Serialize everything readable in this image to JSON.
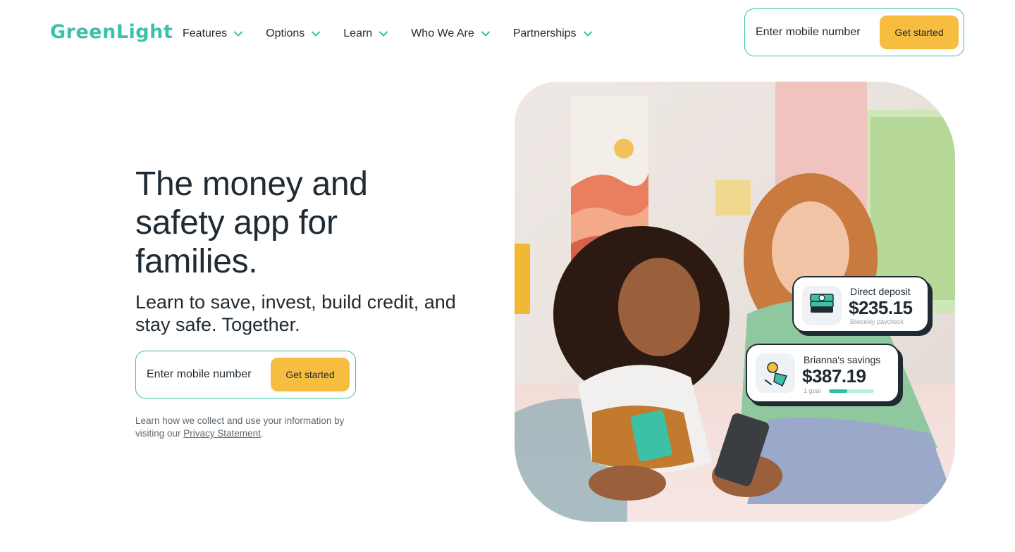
{
  "colors": {
    "brand": "#3cc0a6",
    "accent": "#f6bd41",
    "text": "#1f2a33"
  },
  "header": {
    "logo_text": "GreenLight",
    "nav": [
      {
        "label": "Features",
        "icon": "chevron-down-icon"
      },
      {
        "label": "Options",
        "icon": "chevron-down-icon"
      },
      {
        "label": "Learn",
        "icon": "chevron-down-icon"
      },
      {
        "label": "Who We Are",
        "icon": "chevron-down-icon"
      },
      {
        "label": "Partnerships",
        "icon": "chevron-down-icon"
      }
    ],
    "signup": {
      "placeholder": "Enter mobile number",
      "button_label": "Get started"
    }
  },
  "hero": {
    "title": "The money and safety app for families.",
    "subtitle": "Learn to save, invest, build credit, and stay safe. Together.",
    "signup": {
      "placeholder": "Enter mobile number",
      "button_label": "Get started"
    },
    "privacy": {
      "prefix": "Learn how we collect and use your information by visiting our ",
      "link": "Privacy Statement",
      "suffix": "."
    }
  },
  "cards": {
    "deposit": {
      "label": "Direct deposit",
      "amount": "$235.15",
      "sub": "Biweekly paycheck",
      "icon": "cash-stack-icon"
    },
    "savings": {
      "label": "Brianna's savings",
      "amount": "$387.19",
      "sub": "1 goal",
      "progress": 0.4,
      "icon": "savings-goal-icon"
    }
  }
}
